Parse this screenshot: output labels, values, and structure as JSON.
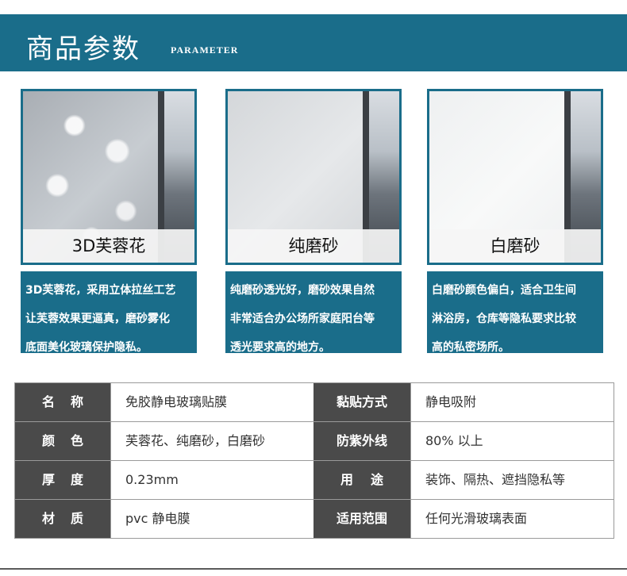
{
  "banner": {
    "title": "商品参数",
    "subtitle": "PARAMETER"
  },
  "cards": [
    {
      "label": "3D芙蓉花",
      "lines": [
        "3D芙蓉花，采用立体拉丝工艺",
        "让芙蓉效果更逼真，磨砂雾化",
        "底面美化玻璃保护隐私。"
      ]
    },
    {
      "label": "纯磨砂",
      "lines": [
        "纯磨砂透光好，磨砂效果自然",
        "非常适合办公场所家庭阳台等",
        "透光要求高的地方。"
      ]
    },
    {
      "label": "白磨砂",
      "lines": [
        "白磨砂颜色偏白，适合卫生间",
        "淋浴房，仓库等隐私要求比较",
        "高的私密场所。"
      ]
    }
  ],
  "table": {
    "rows": [
      {
        "k1a": "名",
        "k1b": "称",
        "v1": "免胶静电玻璃贴膜",
        "k2": "黏贴方式",
        "v2": "静电吸附"
      },
      {
        "k1a": "颜",
        "k1b": "色",
        "v1": "芙蓉花、纯磨砂，白磨砂",
        "k2": "防紫外线",
        "v2": "80% 以上"
      },
      {
        "k1a": "厚",
        "k1b": "度",
        "v1": "0.23mm",
        "k2a": "用",
        "k2b": "途",
        "v2": "装饰、隔热、遮挡隐私等"
      },
      {
        "k1a": "材",
        "k1b": "质",
        "v1": "pvc 静电膜",
        "k2": "适用范围",
        "v2": "任何光滑玻璃表面"
      }
    ]
  },
  "colors": {
    "accent": "#1a6d8a",
    "header_cell": "#4a4a4a"
  }
}
